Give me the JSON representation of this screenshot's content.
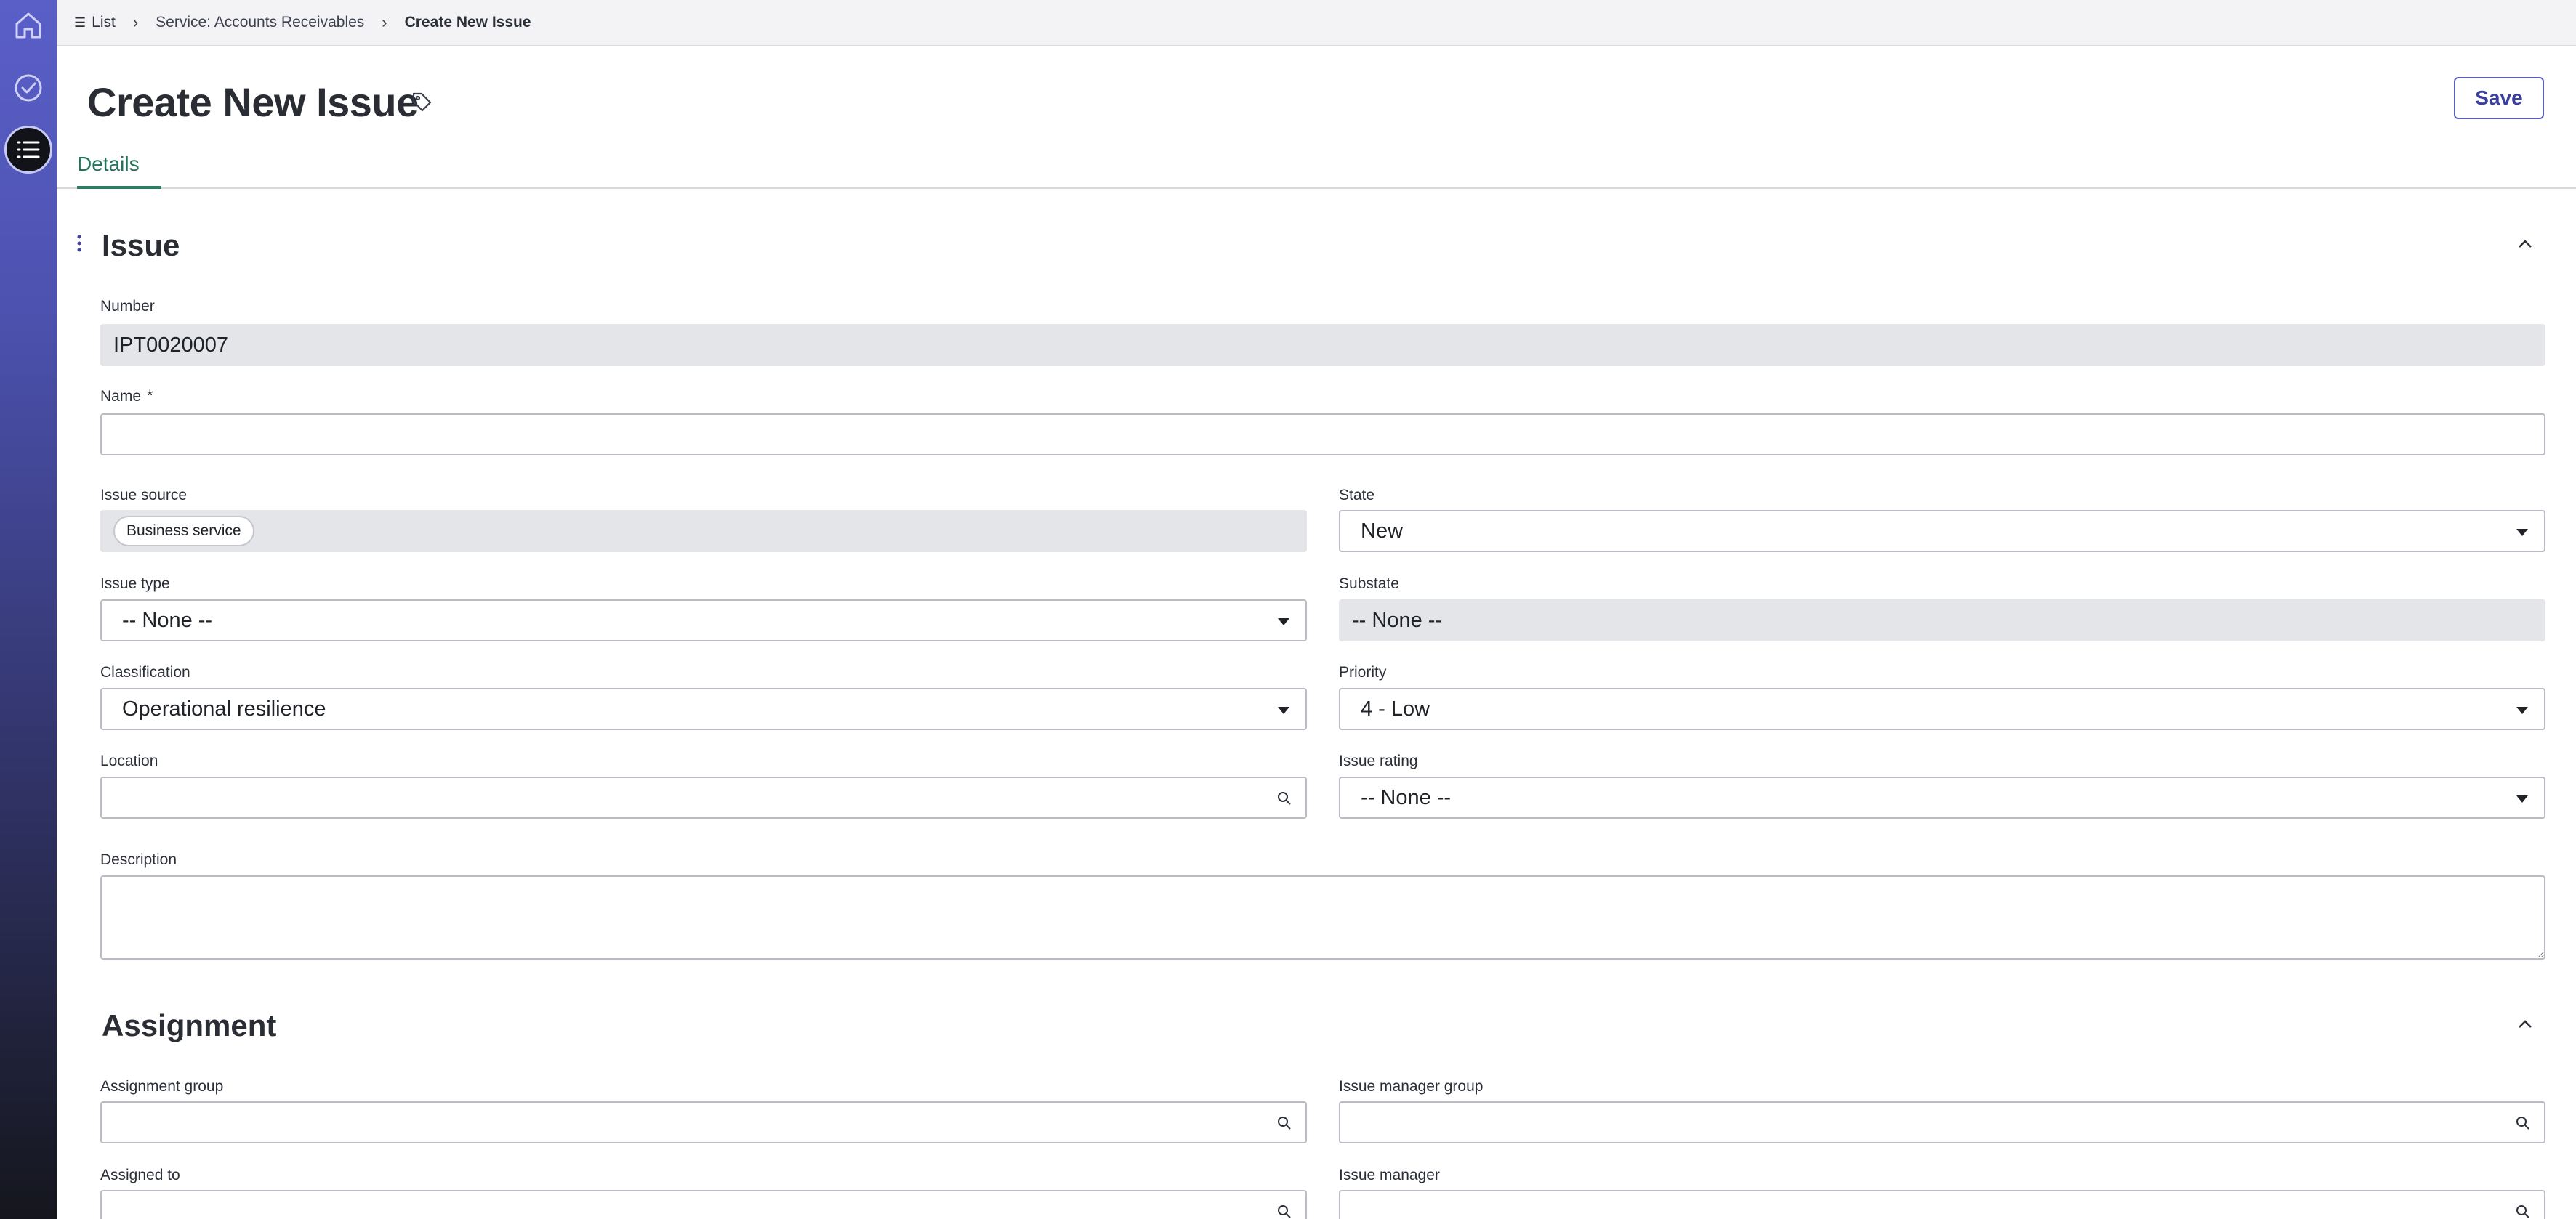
{
  "breadcrumb": {
    "items": [
      "List",
      "Service: Accounts Receivables",
      "Create New Issue"
    ]
  },
  "header": {
    "title": "Create New Issue",
    "save_label": "Save"
  },
  "tabs": [
    {
      "label": "Details",
      "active": true
    }
  ],
  "sections": {
    "issue": {
      "title": "Issue",
      "number_label": "Number",
      "number_value": "IPT0020007",
      "name_label": "Name",
      "name_required": "*",
      "issue_source_label": "Issue source",
      "issue_source_value": "Business service",
      "state_label": "State",
      "state_value": "New",
      "issue_type_label": "Issue type",
      "issue_type_value": "-- None --",
      "substate_label": "Substate",
      "substate_value": "-- None --",
      "classification_label": "Classification",
      "classification_value": "Operational resilience",
      "priority_label": "Priority",
      "priority_value": "4 - Low",
      "location_label": "Location",
      "issue_rating_label": "Issue rating",
      "issue_rating_value": "-- None --",
      "description_label": "Description"
    },
    "assignment": {
      "title": "Assignment",
      "assignment_group_label": "Assignment group",
      "issue_manager_group_label": "Issue manager group",
      "assigned_to_label": "Assigned to",
      "issue_manager_label": "Issue manager"
    }
  },
  "icons": {
    "sidebar": [
      "home-icon",
      "check-circle-icon",
      "list-icon"
    ],
    "accent": "#5a5fc8",
    "tab_accent": "#2d7d64"
  }
}
